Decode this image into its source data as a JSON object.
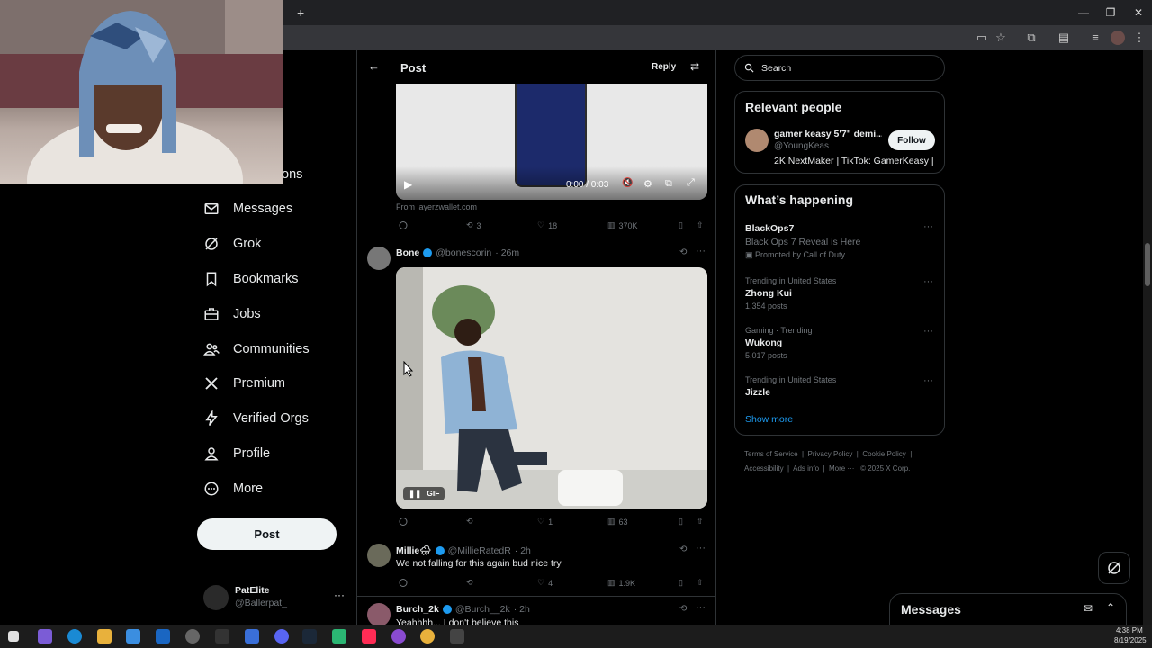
{
  "browser": {
    "new_tab_symbol": "+",
    "window_controls": [
      "—",
      "❐",
      "✕"
    ]
  },
  "sidebar": {
    "partial_label": "ons",
    "items": [
      {
        "label": "Messages",
        "icon": "envelope-icon"
      },
      {
        "label": "Grok",
        "icon": "grok-icon"
      },
      {
        "label": "Bookmarks",
        "icon": "bookmark-icon"
      },
      {
        "label": "Jobs",
        "icon": "briefcase-icon"
      },
      {
        "label": "Communities",
        "icon": "people-icon"
      },
      {
        "label": "Premium",
        "icon": "x-logo-icon"
      },
      {
        "label": "Verified Orgs",
        "icon": "lightning-icon"
      },
      {
        "label": "Profile",
        "icon": "person-icon"
      },
      {
        "label": "More",
        "icon": "more-circle-icon"
      }
    ],
    "post_label": "Post",
    "account": {
      "name": "PatElite",
      "handle": "@Ballerpat_",
      "more": "···"
    }
  },
  "header": {
    "title": "Post",
    "reply_label": "Reply"
  },
  "video_post": {
    "time": "0:00 / 0:03",
    "from": "From layerzwallet.com",
    "reposts": "3",
    "likes": "18",
    "views": "370K"
  },
  "posts": [
    {
      "name": "Bone",
      "handle": "@bonescorin",
      "time": "· 26m",
      "gif_label": "GIF",
      "replies": "",
      "reposts": "",
      "likes": "1",
      "views": "63"
    },
    {
      "name": "Millie🌧",
      "handle": "@MillieRatedR",
      "time": "· 2h",
      "text": "We not falling for this again bud nice try",
      "likes": "4",
      "views": "1.9K"
    },
    {
      "name": "Burch_2k",
      "handle": "@Burch__2k",
      "time": "· 2h",
      "text": "Yeahhhh... I don't believe this"
    }
  ],
  "right": {
    "search_placeholder": "Search",
    "relevant_title": "Relevant people",
    "person": {
      "name": "gamer keasy 5'7\" demi...",
      "handle": "@YoungKeas",
      "bio": "2K NextMaker | TikTok: GamerKeasy |",
      "follow": "Follow"
    },
    "happening_title": "What’s happening",
    "trends": [
      {
        "title": "BlackOps7",
        "desc": "Black Ops 7 Reveal is Here",
        "promo": "Promoted by Call of Duty"
      },
      {
        "context": "Trending in United States",
        "title": "Zhong Kui",
        "count": "1,354 posts"
      },
      {
        "context": "Gaming · Trending",
        "title": "Wukong",
        "count": "5,017 posts"
      },
      {
        "context": "Trending in United States",
        "title": "Jizzle"
      }
    ],
    "show_more": "Show more",
    "footer": [
      "Terms of Service",
      "Privacy Policy",
      "Cookie Policy",
      "Accessibility",
      "Ads info",
      "More ···",
      "© 2025 X Corp."
    ],
    "messages_label": "Messages"
  },
  "taskbar": {
    "time": "4:38 PM",
    "date": "8/19/2025"
  }
}
